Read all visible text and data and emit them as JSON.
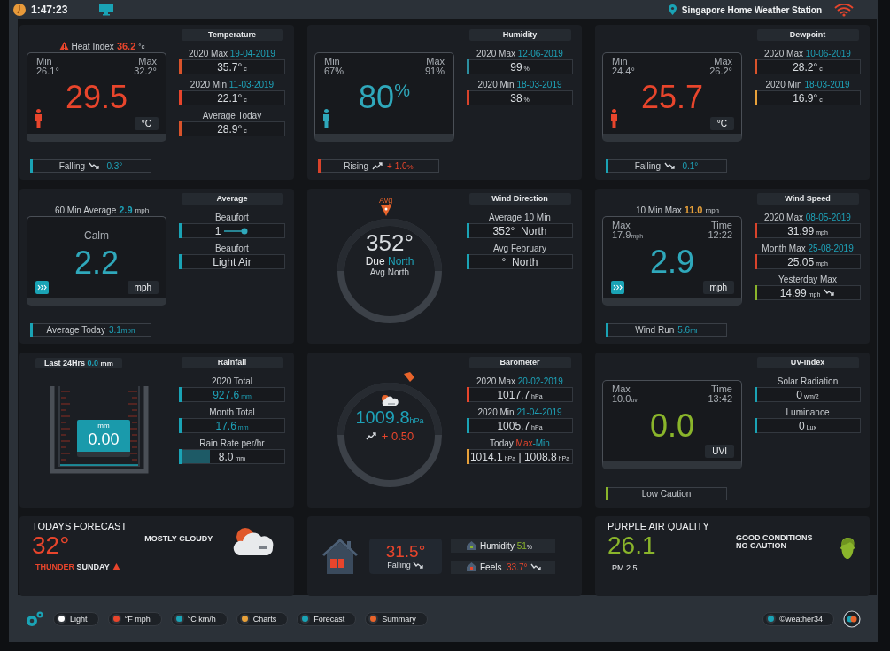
{
  "header": {
    "time": "1:47:23",
    "station": "Singapore Home Weather Station"
  },
  "cards": [
    {
      "kind": "climate",
      "title": "Temperature",
      "note": {
        "label": "Heat Index",
        "value": "36.2",
        "unit": "°c",
        "color": "#e8452c",
        "warning": true
      },
      "panel": {
        "left": {
          "label": "Min",
          "value": "26.1°"
        },
        "right": {
          "label": "Max",
          "value": "32.2°"
        },
        "reading": "29.5",
        "unit": "°C",
        "color": "#e8452c"
      },
      "trend": {
        "kind": "falling",
        "label": "Falling",
        "value": "-0.3°",
        "color": "#1aa3b5"
      },
      "stats": [
        {
          "label": "2020 Max",
          "date": "19-04-2019",
          "value": "35.7°",
          "unit": "c",
          "color": "#d9532b"
        },
        {
          "label": "2020 Min",
          "date": "11-03-2019",
          "value": "22.1°",
          "unit": "c",
          "color": "#e8452c"
        },
        {
          "label": "Average Today",
          "value": "28.9°",
          "unit": "c",
          "color": "#d9532b"
        }
      ]
    },
    {
      "kind": "climate",
      "title": "Humidity",
      "panel": {
        "left": {
          "label": "Min",
          "value": "67%"
        },
        "right": {
          "label": "Max",
          "value": "91%"
        },
        "reading": "80",
        "sup": "%",
        "color": "#2fa8bb"
      },
      "trend": {
        "kind": "rising",
        "label": "Rising",
        "value": "+ 1.0",
        "unit": "%",
        "color": "#d9432b"
      },
      "stats": [
        {
          "label": "2020 Max",
          "date": "12-06-2019",
          "value": "99",
          "unit": "%",
          "color": "#2c8fa0"
        },
        {
          "label": "2020 Min",
          "date": "18-03-2019",
          "value": "38",
          "unit": "%",
          "color": "#d9432b"
        }
      ]
    },
    {
      "kind": "climate",
      "title": "Dewpoint",
      "panel": {
        "left": {
          "label": "Min",
          "value": "24.4°"
        },
        "right": {
          "label": "Max",
          "value": "26.2°"
        },
        "reading": "25.7",
        "unit": "°C",
        "color": "#e8452c"
      },
      "trend": {
        "kind": "falling",
        "label": "Falling",
        "value": "-0.1°",
        "color": "#1aa3b5"
      },
      "stats": [
        {
          "label": "2020 Max",
          "date": "10-06-2019",
          "value": "28.2°",
          "unit": "c",
          "color": "#d9532b"
        },
        {
          "label": "2020 Min",
          "date": "18-03-2019",
          "value": "16.9°",
          "unit": "c",
          "color": "#e8a13a"
        }
      ]
    },
    {
      "kind": "wind",
      "title": "Average",
      "note": {
        "label": "60 Min Average",
        "value": "2.9",
        "unit": "mph",
        "color": "#1ea2b8"
      },
      "panel": {
        "caption": "Calm",
        "reading": "2.2",
        "unit": "mph",
        "color": "#2fa8bb"
      },
      "trend": {
        "label": "Average Today",
        "value": "3.1",
        "unit": "mph",
        "color": "#1aa3b5"
      },
      "stats": [
        {
          "label": "Beaufort",
          "value": "1",
          "scale_icon": true,
          "color": "#1aa3b5"
        },
        {
          "label": "Beaufort",
          "value": "Light Air",
          "color": "#1aa3b5"
        }
      ]
    },
    {
      "kind": "compass",
      "title": "Wind Direction",
      "marker": "Avg",
      "bearing": "352°",
      "due": "Due",
      "due_dir": "North",
      "avg": "Avg North",
      "stats": [
        {
          "label": "Average 10 Min",
          "value": "352°",
          "dir": "North",
          "color": "#1aa3b5"
        },
        {
          "label": "Avg February",
          "value": "°",
          "dir": "North",
          "color": "#1aa3b5"
        }
      ]
    },
    {
      "kind": "wind",
      "title": "Wind Speed",
      "note": {
        "label": "10 Min Max",
        "value": "11.0",
        "unit": "mph",
        "color": "#e8a13a"
      },
      "panel": {
        "left": {
          "label": "Max",
          "value": "17.9",
          "unit": "mph"
        },
        "right": {
          "label": "Time",
          "value": "12:22"
        },
        "reading": "2.9",
        "unit": "mph",
        "color": "#2fa8bb"
      },
      "trend": {
        "label": "Wind Run",
        "value": "5.6",
        "unit": "mi",
        "color": "#1aa3b5"
      },
      "stats": [
        {
          "label": "2020 Max",
          "date": "08-05-2019",
          "value": "31.99",
          "unit": "mph",
          "color": "#d9432b"
        },
        {
          "label": "Month Max",
          "date": "25-08-2019",
          "value": "25.05",
          "unit": "mph",
          "color": "#d9432b"
        },
        {
          "kind": "falling",
          "label": "Yesterday Max",
          "value": "14.99",
          "unit": "mph",
          "color": "#8ab52b"
        }
      ]
    },
    {
      "kind": "rain",
      "title": "Rainfall",
      "note": {
        "label": "Last 24Hrs",
        "value": "0.0",
        "unit": "mm",
        "color": "#1ea2b8"
      },
      "gauge": {
        "unit": "mm",
        "value": "0.00"
      },
      "stats": [
        {
          "label": "2020 Total",
          "value": "927.6",
          "unit": "mm",
          "highlight": true,
          "color": "#1aa3b5"
        },
        {
          "label": "Month Total",
          "value": "17.6",
          "unit": "mm",
          "highlight": true,
          "color": "#1aa3b5"
        },
        {
          "label": "Rain Rate per/hr",
          "value": "8.0",
          "unit": "mm",
          "level": 0.3,
          "color": "#1aa3b5"
        }
      ]
    },
    {
      "kind": "barometer",
      "title": "Barometer",
      "reading": "1009.8",
      "unit": "hPa",
      "change": {
        "kind": "rising",
        "value": "+ 0.50"
      },
      "stats": [
        {
          "label": "2020 Max",
          "date": "20-02-2019",
          "value": "1017.7",
          "unit": "hPa",
          "color": "#e8452c"
        },
        {
          "label": "2020 Min",
          "date": "21-04-2019",
          "value": "1005.7",
          "unit": "hPa",
          "color": "#1aa3b5"
        },
        {
          "label": "Today",
          "hi": "Max",
          "lo": "-Min",
          "value": "1014.1",
          "unit": "hPa",
          "sep": "|",
          "value2": "1008.8",
          "unit2": "hPa",
          "color": "#e8a13a"
        }
      ]
    },
    {
      "kind": "uv",
      "title": "UV-Index",
      "panel": {
        "left": {
          "label": "Max",
          "value": "10.0",
          "unit": "uvi"
        },
        "right": {
          "label": "Time",
          "value": "13:42"
        },
        "reading": "0.0",
        "unit": "UVI",
        "color": "#8ab52b"
      },
      "trend": {
        "label": "Low Caution",
        "color": "#8ab52b"
      },
      "stats": [
        {
          "label": "Solar Radiation",
          "value": "0",
          "unit": "wm/2",
          "color": "#1aa3b5"
        },
        {
          "label": "Luminance",
          "value": "0",
          "unit": "Lux",
          "color": "#1aa3b5"
        }
      ]
    },
    {
      "kind": "forecast",
      "title": "TODAYS FORECAST",
      "temp": "32°",
      "summary": "MOSTLY CLOUDY",
      "alert": "THUNDER",
      "day": "SUNDAY"
    },
    {
      "kind": "indoor",
      "temp": "31.5°",
      "trend": "Falling",
      "humidity_label": "Humidity",
      "humidity": "51",
      "humidity_unit": "%",
      "feels_label": "Feels",
      "feels": "33.7°"
    },
    {
      "kind": "air",
      "title": "PURPLE AIR QUALITY",
      "value": "26.1",
      "unit": "PM 2.5",
      "lines": [
        "GOOD CONDITIONS",
        "NO CAUTION"
      ]
    }
  ],
  "footer": {
    "buttons": [
      {
        "label": "Light",
        "color": "#ffffff"
      },
      {
        "label": "°F mph",
        "color": "#e8452c"
      },
      {
        "label": "°C km/h",
        "color": "#1aa3b5"
      },
      {
        "label": "Charts",
        "color": "#e8a13a"
      },
      {
        "label": "Forecast",
        "color": "#1aa3b5"
      },
      {
        "label": "Summary",
        "color": "#e8642b"
      }
    ],
    "credit": {
      "label": "©weather34",
      "color": "#1aa3b5"
    }
  }
}
